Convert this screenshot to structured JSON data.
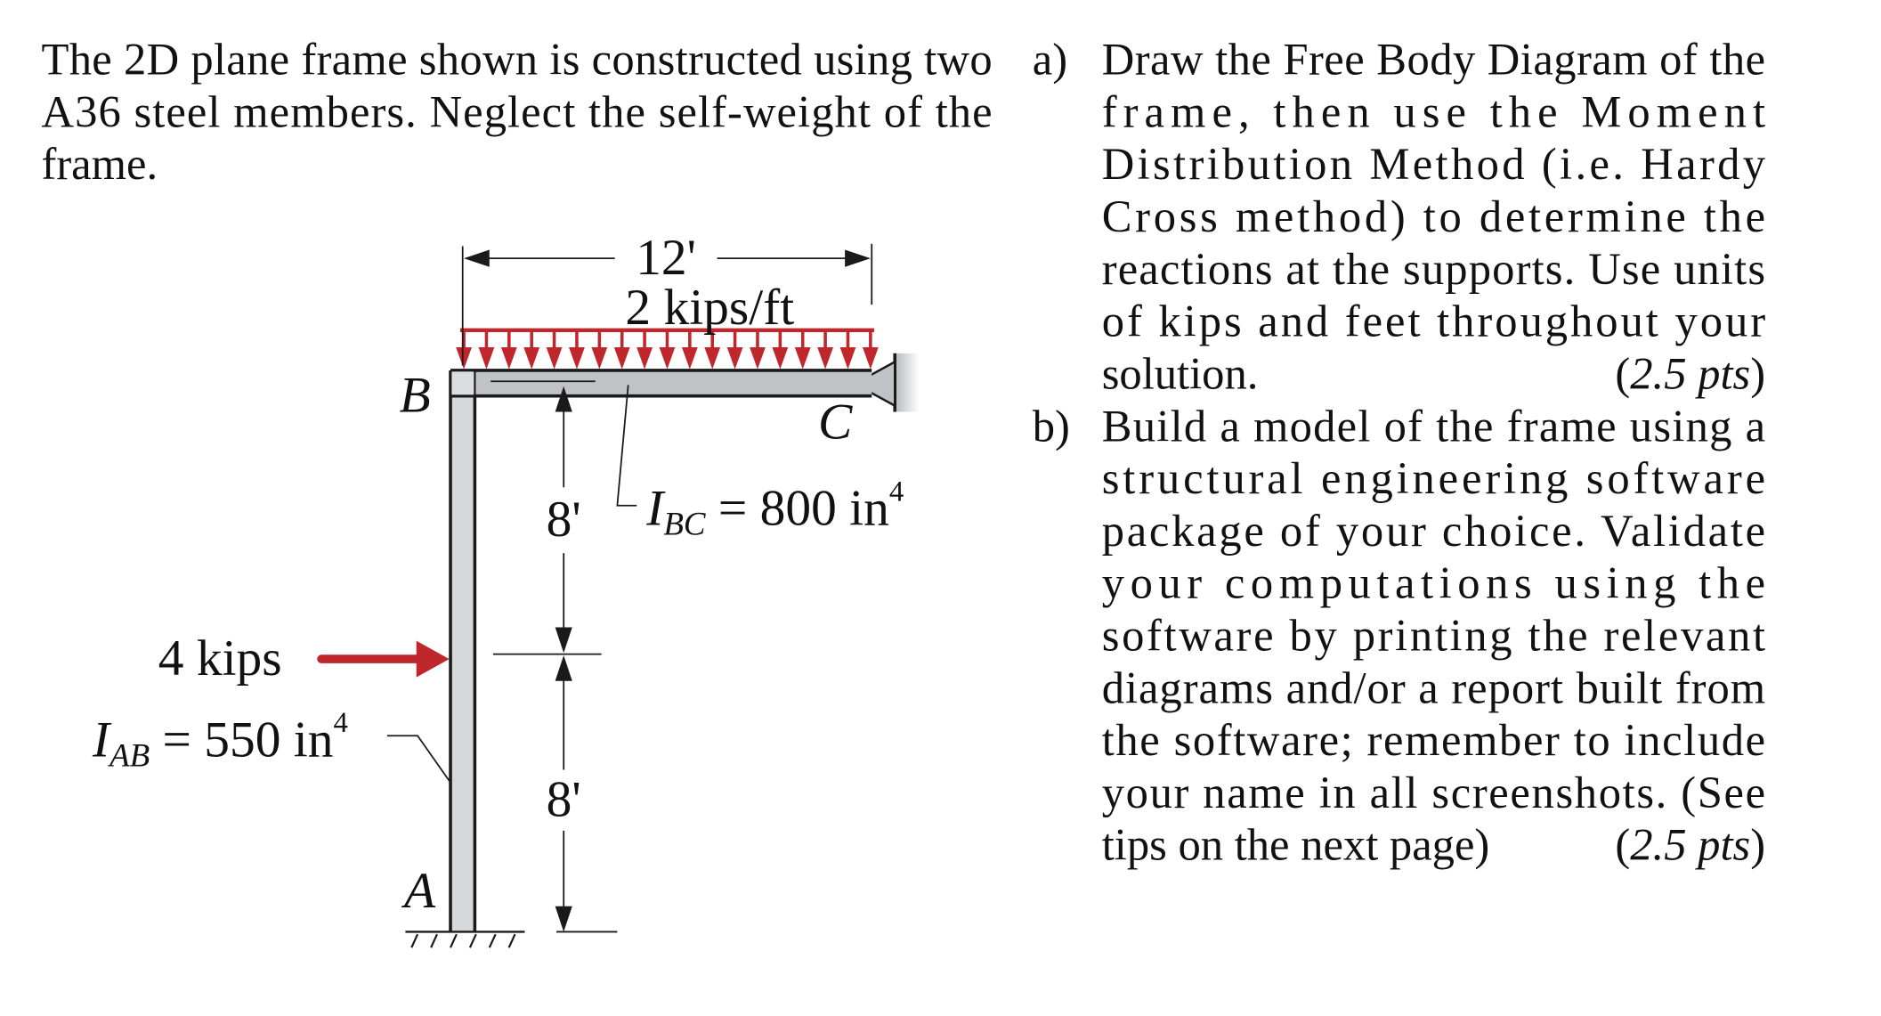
{
  "problem": {
    "intro_lines": [
      "The 2D plane frame shown is constructed using two",
      "A36 steel members.  Neglect the self-weight of the",
      "frame."
    ],
    "parts": [
      {
        "label": "a)",
        "lines": [
          "Draw the Free Body Diagram of the",
          "frame, then use the Moment",
          "Distribution Method (i.e. Hardy",
          "Cross method) to determine the",
          "reactions at the supports.  Use units",
          "of kips and feet throughout your",
          "solution."
        ],
        "points": "(2.5 pts)",
        "points_value": "2.5",
        "points_unit": "pts"
      },
      {
        "label": "b)",
        "lines": [
          "Build a model of the frame using a",
          "structural engineering software",
          "package of your choice.  Validate",
          "your computations using the",
          "software by printing the relevant",
          "diagrams and/or a report built from",
          "the software; remember to include",
          "your name in all screenshots.  (See",
          "tips on the next page)"
        ],
        "points": "(2.5 pts)",
        "points_value": "2.5",
        "points_unit": "pts"
      }
    ]
  },
  "figure": {
    "joints": {
      "A": "A",
      "B": "B",
      "C": "C"
    },
    "span_bc": "12'",
    "distributed_load": "2 kips/ft",
    "distributed_load_arrow_count": 19,
    "point_load": "4 kips",
    "height_upper": "8'",
    "height_lower": "8'",
    "i_bc": {
      "symbol": "I",
      "sub": "BC",
      "eq": " = 800 in",
      "exp": "4"
    },
    "i_ab": {
      "symbol": "I",
      "sub": "AB",
      "eq": " = 550 in",
      "exp": "4"
    },
    "supports": {
      "A": "fixed",
      "C": "pin"
    },
    "colors": {
      "load": "#c0272d",
      "beam_fill": "#c0c2c6",
      "column_fill": "#d6d7d9",
      "ink": "#111111"
    }
  }
}
